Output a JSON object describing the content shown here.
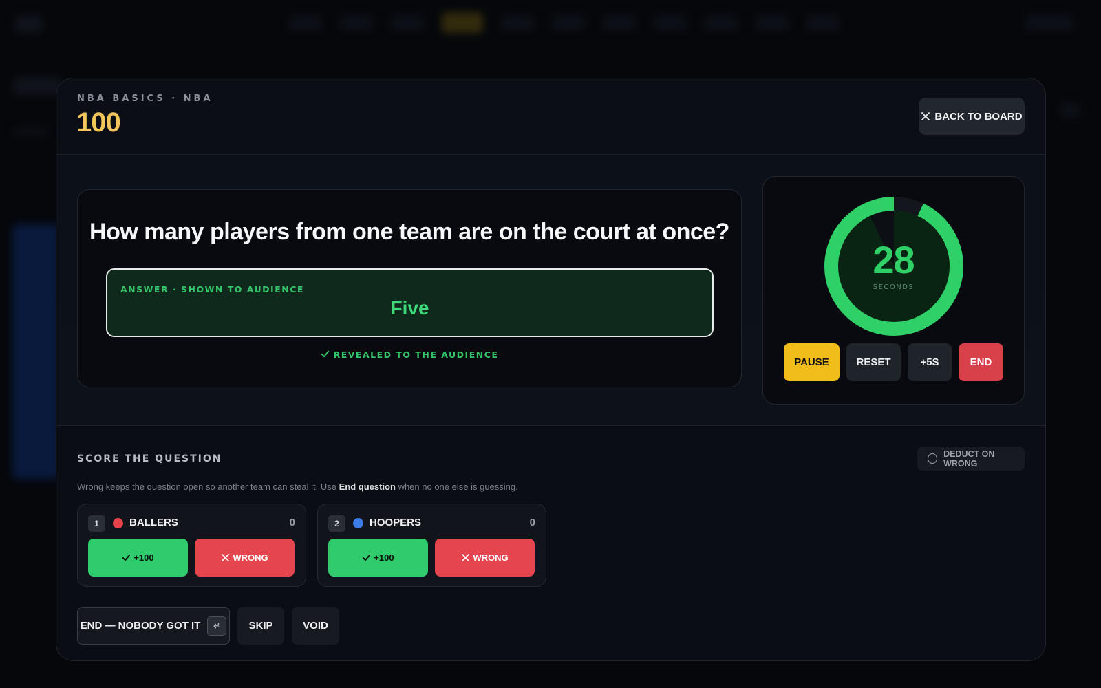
{
  "header": {
    "crumb": "NBA BASICS · NBA",
    "points": "100",
    "back_label": "BACK TO BOARD"
  },
  "question": {
    "text": "How many players from one team are on the court at once?",
    "answer_label": "ANSWER · SHOWN TO AUDIENCE",
    "answer_value": "Five",
    "revealed_label": "REVEALED TO THE AUDIENCE"
  },
  "timer": {
    "seconds": "28",
    "unit": "SECONDS",
    "remaining_fraction": 0.93,
    "color": "#2fd067",
    "buttons": {
      "pause": "PAUSE",
      "reset": "RESET",
      "plus": "+5S",
      "end": "END"
    }
  },
  "scoring": {
    "title": "SCORE THE QUESTION",
    "deduct_label": "DEDUCT ON WRONG",
    "deduct_checked": false,
    "hint_before": "Wrong keeps the question open so another team can steal it. Use ",
    "hint_bold": "End question",
    "hint_after": " when no one else is guessing.",
    "teams": [
      {
        "num": "1",
        "name": "BALLERS",
        "score": "0",
        "color": "#e5434c",
        "correct_label": "+100",
        "wrong_label": "WRONG"
      },
      {
        "num": "2",
        "name": "HOOPERS",
        "score": "0",
        "color": "#3c7ce8",
        "correct_label": "+100",
        "wrong_label": "WRONG"
      }
    ],
    "actions": {
      "end_nobody": "END — NOBODY GOT IT",
      "end_key": "⏎",
      "skip": "SKIP",
      "void": "VOID"
    }
  }
}
